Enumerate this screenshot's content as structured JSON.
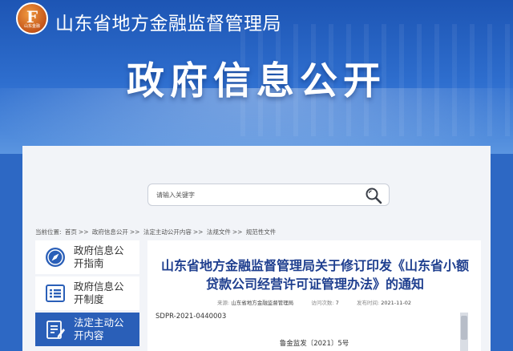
{
  "header": {
    "logo_glyph": "F",
    "logo_mini": "山东金融",
    "org_title": "山东省地方金融监督管理局",
    "banner_title": "政府信息公开"
  },
  "search": {
    "placeholder": "请输入关键字",
    "icon": "search-icon"
  },
  "breadcrumb": {
    "prefix": "当前位置:",
    "items": [
      "首页",
      "政府信息公开",
      "法定主动公开内容",
      "法规文件",
      "规范性文件"
    ],
    "separator": ">>"
  },
  "sidebar": {
    "items": [
      {
        "label": "政府信息公开指南",
        "icon": "compass-icon",
        "active": false
      },
      {
        "label": "政府信息公开制度",
        "icon": "list-icon",
        "active": false
      },
      {
        "label": "法定主动公开内容",
        "icon": "edit-document-icon",
        "active": true
      }
    ]
  },
  "article": {
    "title": "山东省地方金融监督管理局关于修订印发《山东省小额贷款公司经营许可证管理办法》的通知",
    "source_label": "来源:",
    "source_value": "山东省地方金融监督管理局",
    "views_label": "访问次数:",
    "views_value": "7",
    "date_label": "发布时间:",
    "date_value": "2021-11-02",
    "doc_id": "SDPR-2021-0440003",
    "doc_number": "鲁金监发〔2021〕5号"
  },
  "colors": {
    "accent": "#2a5fb8",
    "title_blue": "#1f3f8f",
    "hero": "#1d55b4"
  }
}
